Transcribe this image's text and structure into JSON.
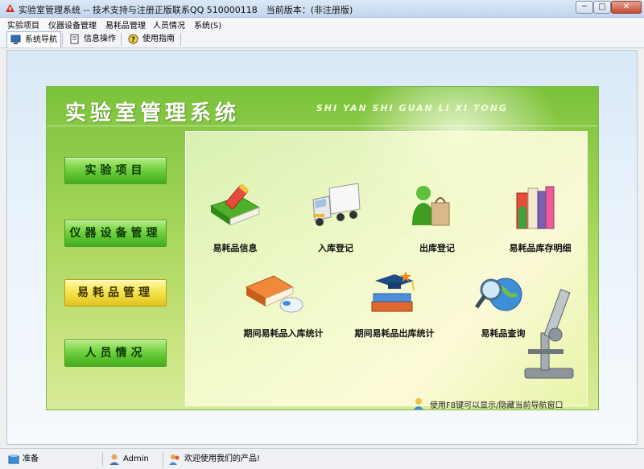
{
  "window": {
    "title": "实验室管理系统 -- 技术支持与注册正版联系QQ 510000118　当前版本：(非注册版)",
    "min_glyph": "─",
    "max_glyph": "□",
    "close_glyph": "✕"
  },
  "menu": [
    "实验项目",
    "仪器设备管理",
    "易耗品管理",
    "人员情况",
    "系统(S)"
  ],
  "toolbar": {
    "tabs": [
      {
        "label": "系统导航",
        "icon": "monitor-icon"
      },
      {
        "label": "信息操作",
        "icon": "document-icon"
      },
      {
        "label": "使用指南",
        "icon": "help-icon"
      }
    ]
  },
  "panel": {
    "title": "实验室管理系统",
    "subtitle": "SHI YAN SHI GUAN LI XI TONG",
    "nav": [
      {
        "label": "实验项目",
        "selected": false
      },
      {
        "label": "仪器设备管理",
        "selected": false
      },
      {
        "label": "易耗品管理",
        "selected": true
      },
      {
        "label": "人员情况",
        "selected": false
      }
    ],
    "actions": [
      {
        "label": "易耗品信息",
        "icon": "green-book-pencil-icon"
      },
      {
        "label": "入库登记",
        "icon": "delivery-truck-icon"
      },
      {
        "label": "出库登记",
        "icon": "shopper-bag-icon"
      },
      {
        "label": "易耗品库存明细",
        "icon": "books-stack-icon"
      },
      {
        "label": "期间易耗品入库统计",
        "icon": "book-mouse-icon"
      },
      {
        "label": "期间易耗品出库统计",
        "icon": "graduation-books-icon"
      },
      {
        "label": "易耗品查询",
        "icon": "magnifier-globe-icon"
      }
    ],
    "hint": "使用F8键可以显示/隐藏当前导航窗口"
  },
  "statusbar": {
    "status": "准备",
    "user": "Admin",
    "welcome": "欢迎使用我们的产品!"
  },
  "colors": {
    "panel_green": "#7bc23b",
    "nav_green": "#6ccd3b",
    "nav_selected": "#f5e24b"
  }
}
